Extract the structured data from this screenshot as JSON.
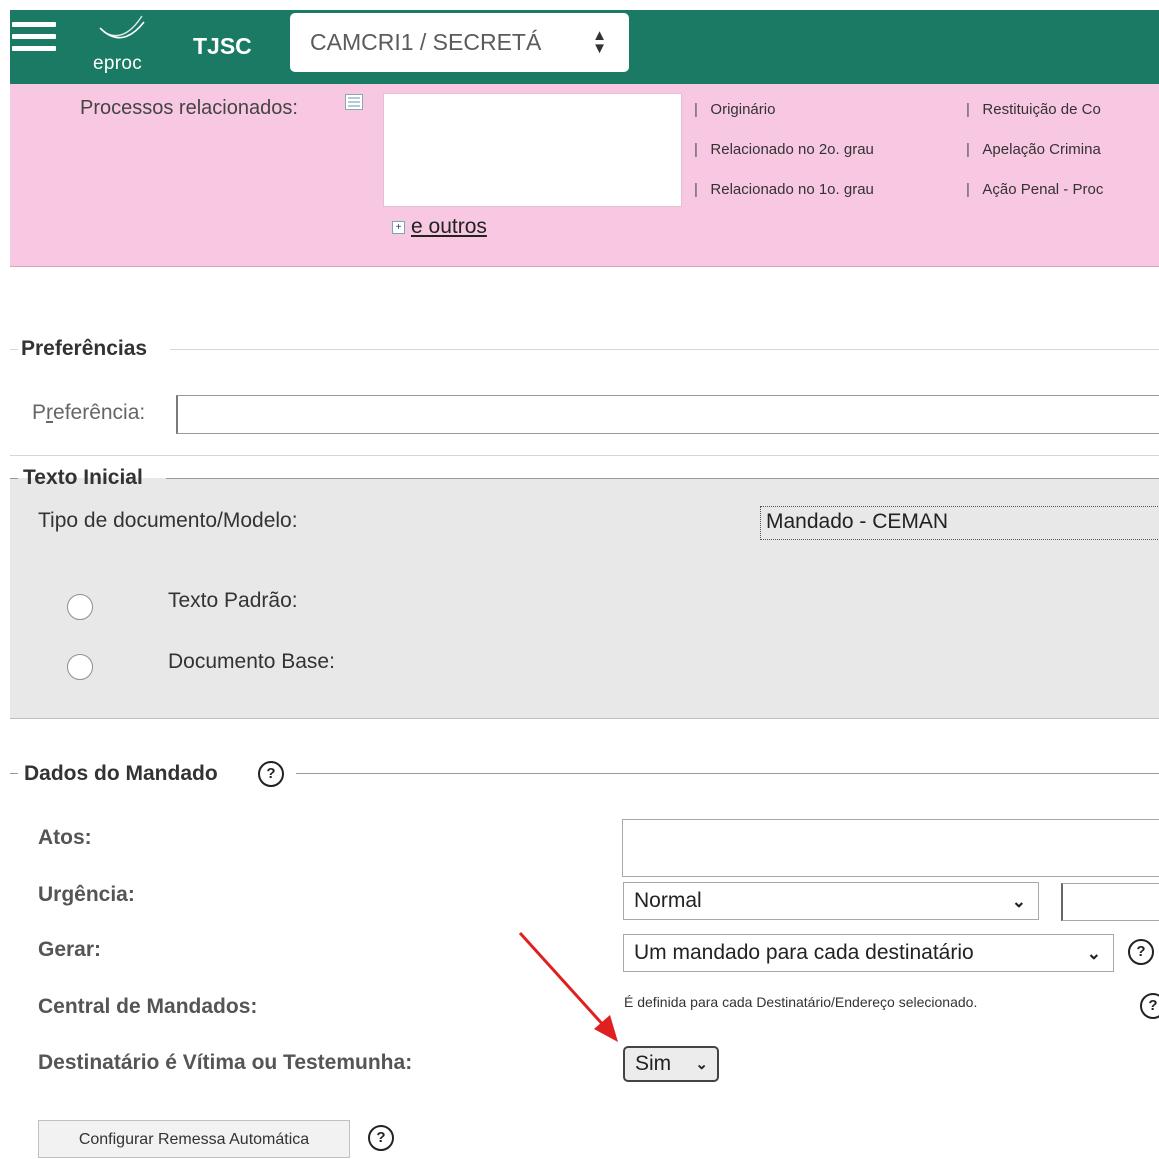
{
  "header": {
    "logo_text": "eproc",
    "court": "TJSC",
    "org_select_value": "CAMCRI1 / SECRETÁ",
    "icons": {
      "menu": "hamburger-icon",
      "logo": "swoosh-logo-icon",
      "select": "updown-arrows-icon"
    }
  },
  "related": {
    "label": "Processos relacionados:",
    "more_link": "e outros",
    "rows": [
      {
        "col1": "Originário",
        "col2": "Restituição de Co"
      },
      {
        "col1": "Relacionado no 2o. grau",
        "col2": "Apelação Crimina"
      },
      {
        "col1": "Relacionado no 1o. grau",
        "col2": "Ação Penal - Proc"
      }
    ]
  },
  "preferencias": {
    "legend": "Preferências",
    "label_prefix": "P",
    "label_accesskey": "r",
    "label_suffix": "eferência:",
    "value": ""
  },
  "texto_inicial": {
    "legend": "Texto Inicial",
    "tipo_label": "Tipo de documento/Modelo:",
    "tipo_value": "Mandado - CEMAN",
    "options": [
      {
        "label": "Texto Padrão:",
        "checked": false
      },
      {
        "label": "Documento Base:",
        "checked": false
      }
    ]
  },
  "dados_mandado": {
    "legend": "Dados do Mandado",
    "help_glyph": "?",
    "atos_label": "Atos:",
    "atos_value": "",
    "urgencia_label": "Urgência:",
    "urgencia_value": "Normal",
    "gerar_label": "Gerar:",
    "gerar_value": "Um mandado para cada destinatário",
    "central_label": "Central de Mandados:",
    "central_value": "É definida para cada Destinatário/Endereço selecionado.",
    "destinatario_label": "Destinatário é Vítima ou Testemunha:",
    "destinatario_value": "Sim",
    "config_button": "Configurar Remessa Automática",
    "annotation_color": "#e02020"
  }
}
